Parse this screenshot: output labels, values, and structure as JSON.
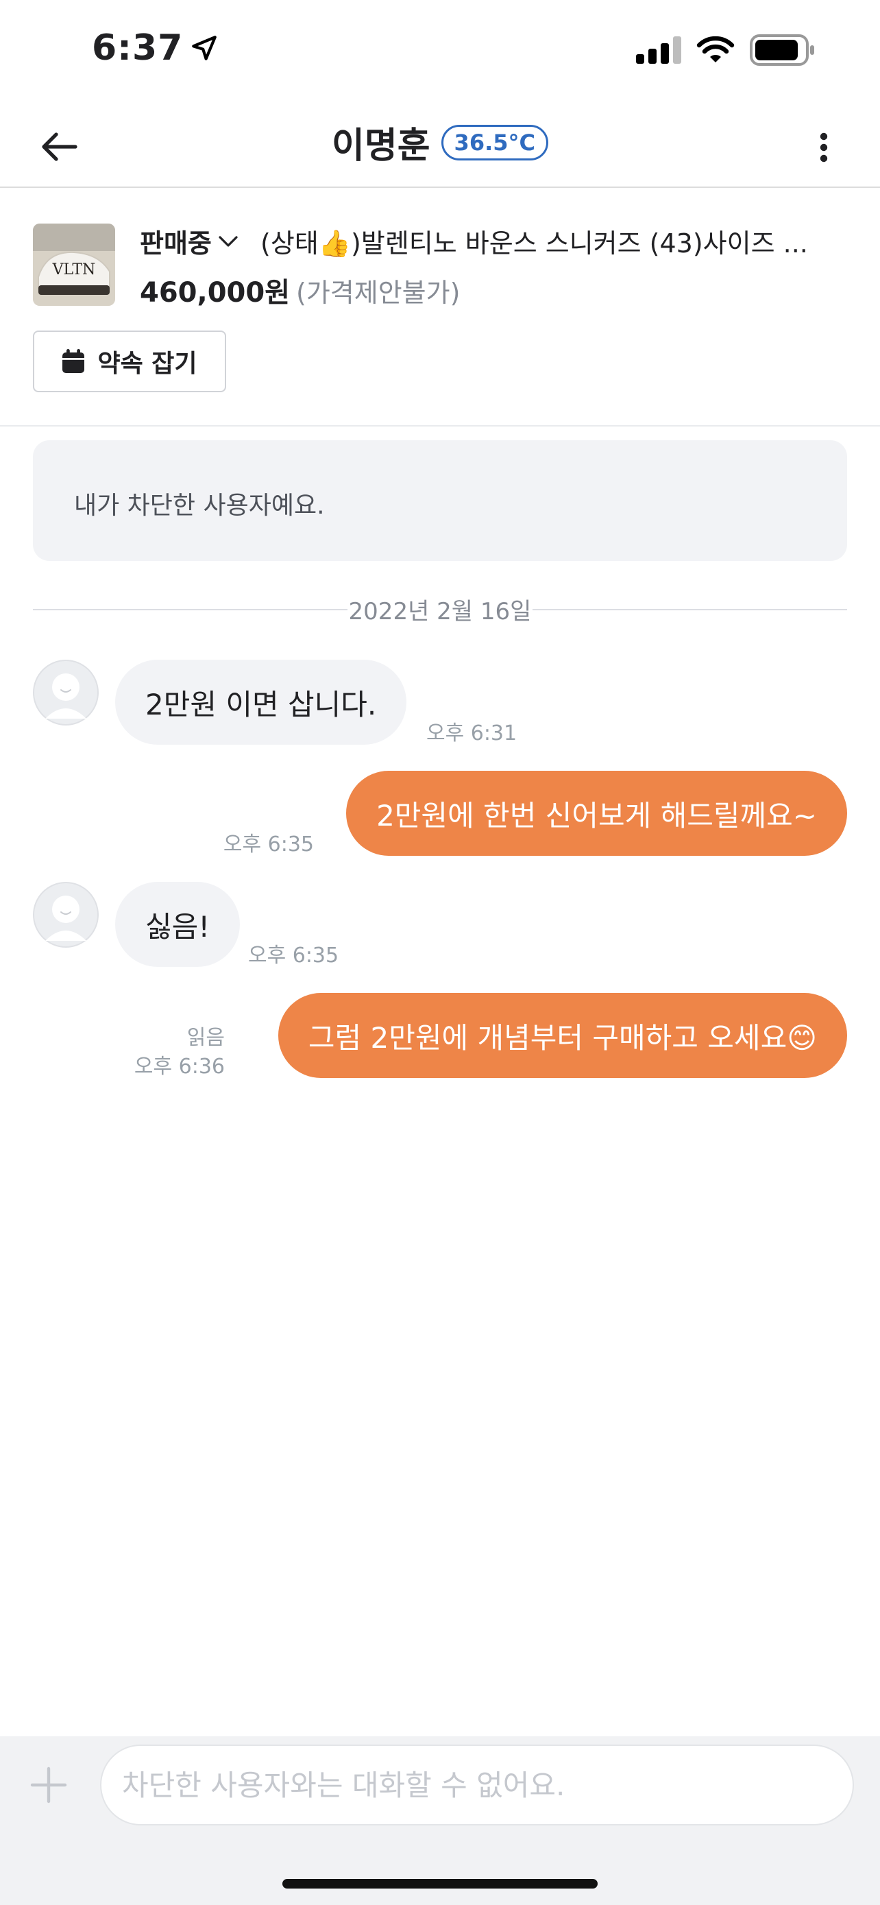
{
  "status_bar": {
    "time": "6:37",
    "icons": [
      "location-arrow-icon",
      "signal-icon",
      "wifi-icon",
      "battery-icon"
    ]
  },
  "header": {
    "title": "이명훈",
    "temperature": "36.5°C",
    "icons": {
      "back": "arrow-left-icon",
      "more": "more-vertical-icon"
    }
  },
  "product": {
    "status": "판매중",
    "title": "(상태👍)발렌티노 바운스 스니커즈 (43)사이즈 ...",
    "price": "460,000원",
    "negotiation": "(가격제안불가)",
    "thumbnail_text": "VLTN",
    "appointment_label": "약속 잡기"
  },
  "notice": {
    "text": "내가 차단한 사용자예요."
  },
  "date_separator": "2022년 2월 16일",
  "messages": [
    {
      "side": "in",
      "text": "2만원 이면 삽니다.",
      "time": "오후 6:31"
    },
    {
      "side": "out",
      "text": "2만원에 한번 신어보게 해드릴께요~",
      "time": "오후 6:35"
    },
    {
      "side": "in",
      "text": "싫음!",
      "time": "오후 6:35"
    },
    {
      "side": "out",
      "text": "그럼 2만원에 개념부터 구매하고 오세요😊",
      "time": "오후 6:36",
      "read": "읽음"
    }
  ],
  "input": {
    "placeholder": "차단한 사용자와는 대화할 수 없어요."
  },
  "colors": {
    "accent": "#ee8548",
    "temperature": "#2f6bbf",
    "incoming_bubble": "#f2f3f6",
    "notice_bg": "#f2f3f6",
    "input_bar_bg": "#f1f2f4"
  }
}
